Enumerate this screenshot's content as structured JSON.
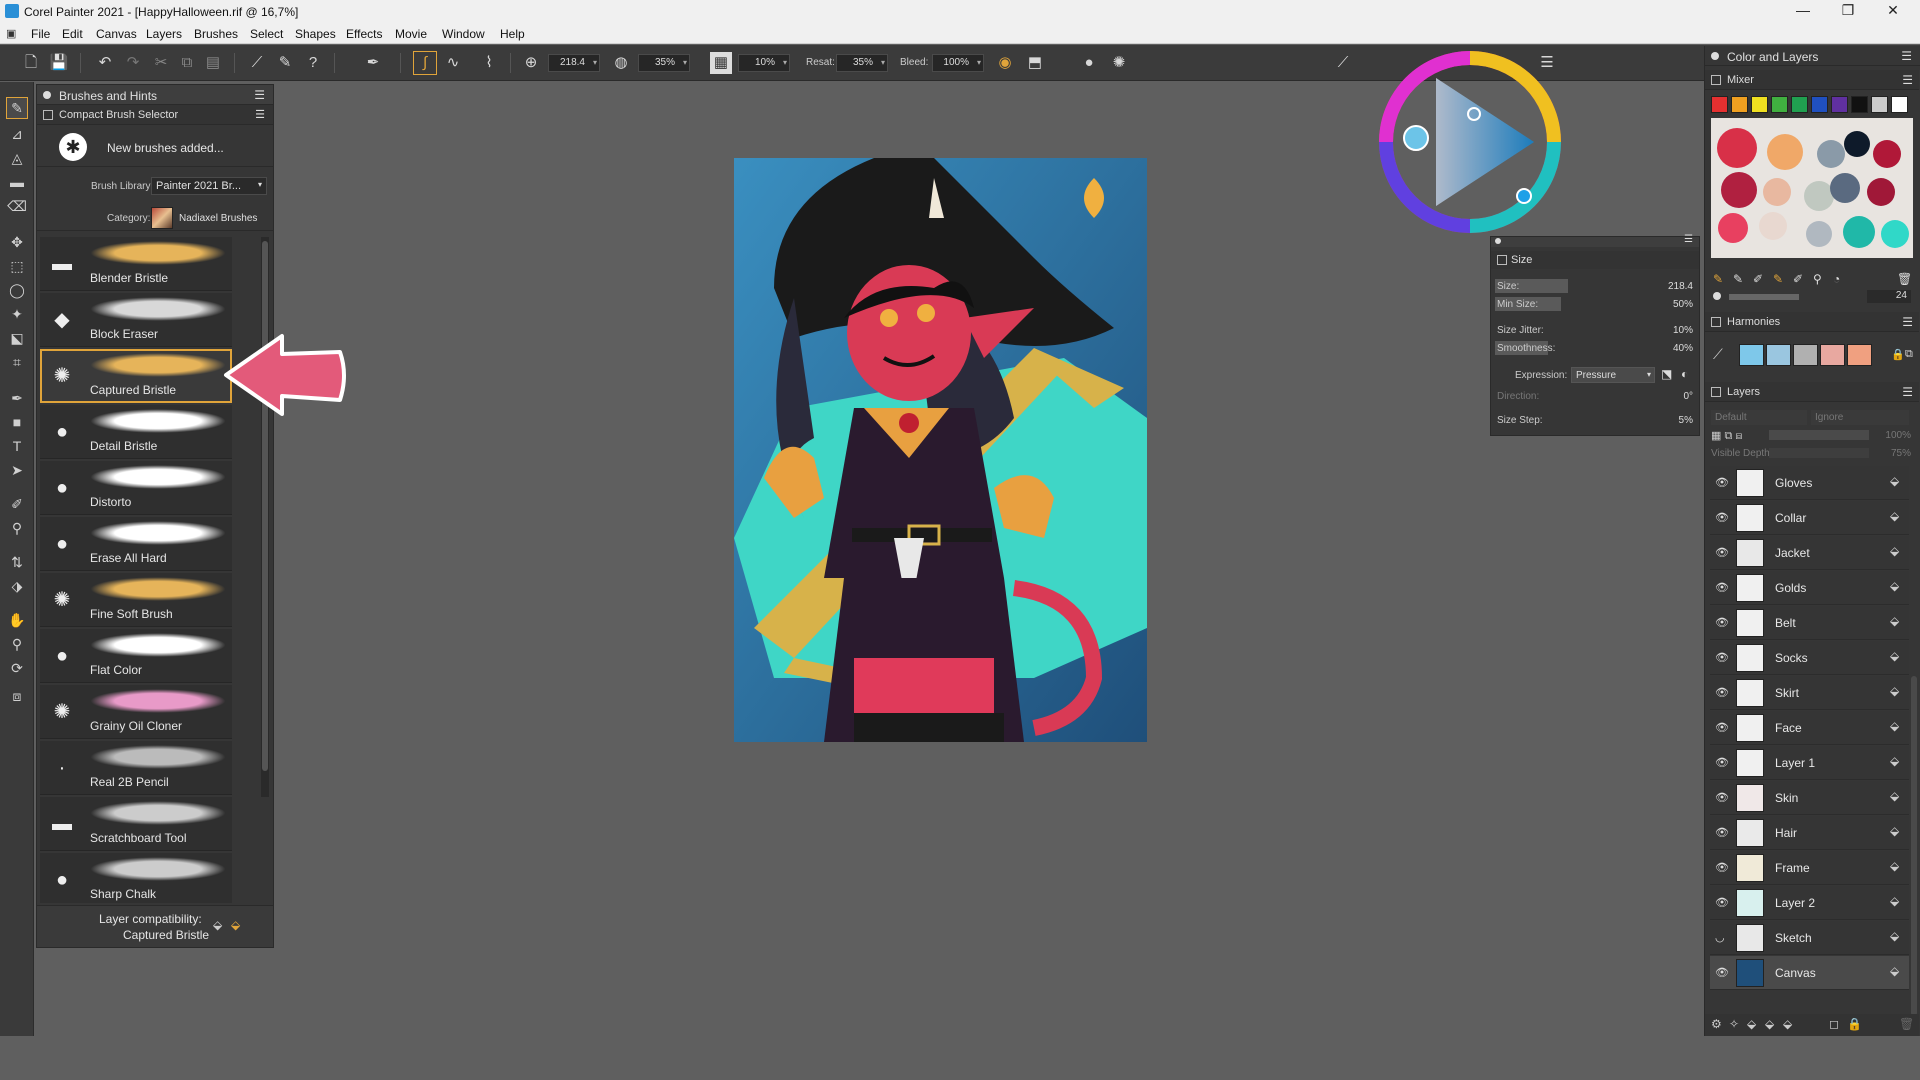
{
  "window": {
    "title": "Corel Painter 2021 - [HappyHalloween.rif @ 16,7%]",
    "min": "—",
    "restore": "❐",
    "close": "✕"
  },
  "menu": [
    "File",
    "Edit",
    "Canvas",
    "Layers",
    "Brushes",
    "Select",
    "Shapes",
    "Effects",
    "Movie",
    "Window",
    "Help"
  ],
  "toolbar": {
    "size_value": "218.4",
    "opacity_value": "35%",
    "grain_value": "10%",
    "resat_label": "Resat:",
    "resat_value": "35%",
    "bleed_label": "Bleed:",
    "bleed_value": "100%"
  },
  "brushes_panel": {
    "title": "Brushes and Hints",
    "sub_title": "Compact Brush Selector",
    "notice": "New brushes added...",
    "library_label": "Brush Library:",
    "library_value": "Painter 2021 Br...",
    "category_label": "Category:",
    "category_value": "Nadiaxel Brushes",
    "brushes": [
      {
        "name": "Blender Bristle",
        "stroke_color": "#e6b45a"
      },
      {
        "name": "Block Eraser",
        "stroke_color": "#d8d8d8"
      },
      {
        "name": "Captured Bristle",
        "stroke_color": "#e6b45a"
      },
      {
        "name": "Detail Bristle",
        "stroke_color": "#ffffff"
      },
      {
        "name": "Distorto",
        "stroke_color": "#ffffff"
      },
      {
        "name": "Erase All Hard",
        "stroke_color": "#ffffff"
      },
      {
        "name": "Fine Soft Brush",
        "stroke_color": "#e6b45a"
      },
      {
        "name": "Flat Color",
        "stroke_color": "#ffffff"
      },
      {
        "name": "Grainy Oil Cloner",
        "stroke_color": "#e89ac8"
      },
      {
        "name": "Real 2B Pencil",
        "stroke_color": "#bbbbbb"
      },
      {
        "name": "Scratchboard Tool",
        "stroke_color": "#cccccc"
      },
      {
        "name": "Sharp Chalk",
        "stroke_color": "#cccccc"
      }
    ],
    "selected_brush": "Captured Bristle",
    "compat_label": "Layer compatibility:",
    "compat_value": "Captured Bristle"
  },
  "color_layers": {
    "title": "Color and Layers",
    "mixer_title": "Mixer",
    "mixer_swatches": [
      "#e53030",
      "#f0a020",
      "#f0e020",
      "#40b040",
      "#20a050",
      "#2050c0",
      "#6030a0",
      "#111111",
      "#cccccc",
      "#ffffff"
    ],
    "mixer_value": "24",
    "harmonies_title": "Harmonies",
    "harmony_colors": [
      "#7ec8ea",
      "#9ac6e0",
      "#b0b0b0",
      "#e8a8a0",
      "#f0a080"
    ],
    "layers_title": "Layers",
    "composite_method": "Default",
    "preserve": "Ignore",
    "opacity": "100%",
    "visible_depth_label": "Visible Depth:",
    "visible_depth_value": "75%",
    "layers": [
      {
        "name": "Gloves",
        "visible": true
      },
      {
        "name": "Collar",
        "visible": true
      },
      {
        "name": "Jacket",
        "visible": true
      },
      {
        "name": "Golds",
        "visible": true
      },
      {
        "name": "Belt",
        "visible": true
      },
      {
        "name": "Socks",
        "visible": true
      },
      {
        "name": "Skirt",
        "visible": true
      },
      {
        "name": "Face",
        "visible": true
      },
      {
        "name": "Layer 1",
        "visible": true
      },
      {
        "name": "Skin",
        "visible": true
      },
      {
        "name": "Hair",
        "visible": true
      },
      {
        "name": "Frame",
        "visible": true
      },
      {
        "name": "Layer 2",
        "visible": true
      },
      {
        "name": "Sketch",
        "visible": false
      },
      {
        "name": "Canvas",
        "visible": true
      }
    ],
    "selected_layer": "Canvas"
  },
  "size_panel": {
    "title": "Size",
    "size_label": "Size:",
    "size_value": "218.4",
    "size_fill": 0.55,
    "min_size_label": "Min Size:",
    "min_size_value": "50%",
    "min_size_fill": 0.5,
    "jitter_label": "Size Jitter:",
    "jitter_value": "10%",
    "smoothness_label": "Smoothness:",
    "smoothness_value": "40%",
    "smoothness_fill": 0.4,
    "expression_label": "Expression:",
    "expression_value": "Pressure",
    "direction_label": "Direction:",
    "direction_value": "0°",
    "step_label": "Size Step:",
    "step_value": "5%"
  },
  "colors": {
    "accent": "#e0a43a",
    "arrow": "#e35a7a"
  }
}
